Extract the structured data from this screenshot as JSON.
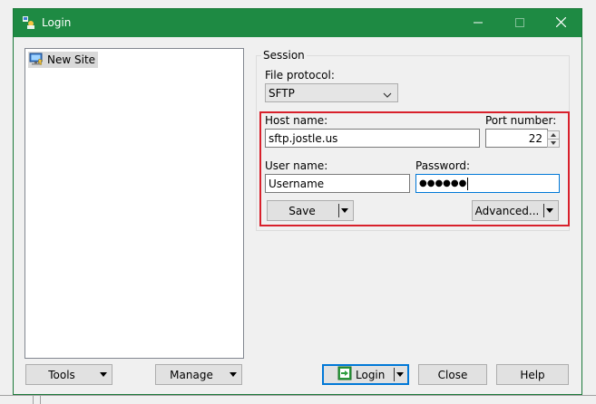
{
  "window": {
    "title": "Login",
    "controls": [
      "minimize-icon",
      "maximize-icon",
      "close-icon"
    ]
  },
  "site_tree": {
    "items": [
      {
        "label": "New Site",
        "icon": "computer-icon",
        "selected": true
      }
    ]
  },
  "left_buttons": {
    "tools_label": "Tools",
    "manage_label": "Manage"
  },
  "session": {
    "group_label": "Session",
    "file_protocol_label": "File protocol:",
    "file_protocol_value": "SFTP",
    "host_label": "Host name:",
    "host_value": "sftp.jostle.us",
    "port_label": "Port number:",
    "port_value": "22",
    "user_label": "User name:",
    "user_value": "Username",
    "password_label": "Password:",
    "password_value": "●●●●●●",
    "save_label": "Save",
    "advanced_label": "Advanced..."
  },
  "bottom_buttons": {
    "login_label": "Login",
    "close_label": "Close",
    "help_label": "Help"
  },
  "colors": {
    "titlebar": "#1e8a43",
    "highlight_border": "#d8202b",
    "focus_border": "#0078d7"
  }
}
